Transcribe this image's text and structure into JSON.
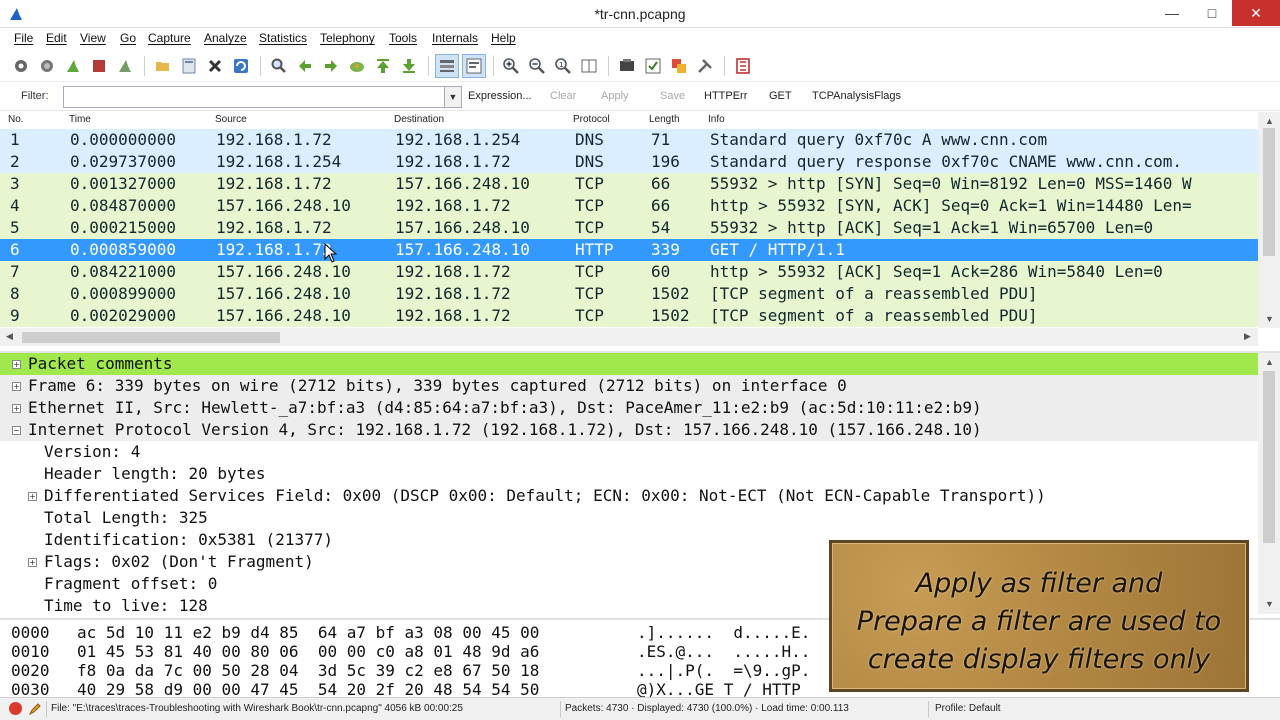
{
  "window": {
    "title": "*tr-cnn.pcapng"
  },
  "menu": [
    "File",
    "Edit",
    "View",
    "Go",
    "Capture",
    "Analyze",
    "Statistics",
    "Telephony",
    "Tools",
    "Internals",
    "Help"
  ],
  "filter": {
    "label": "Filter:",
    "value": "",
    "links": [
      "Expression...",
      "Clear",
      "Apply",
      "Save",
      "HTTPErr",
      "GET",
      "TCPAnalysisFlags"
    ]
  },
  "packet_list": {
    "headers": [
      "No.",
      "Time",
      "Source",
      "Destination",
      "Protocol",
      "Length",
      "Info"
    ],
    "rows": [
      {
        "no": "1",
        "time": "0.000000000",
        "src": "192.168.1.72",
        "dst": "192.168.1.254",
        "proto": "DNS",
        "len": "71",
        "info": "Standard query 0xf70c  A www.cnn.com",
        "kind": "dns"
      },
      {
        "no": "2",
        "time": "0.029737000",
        "src": "192.168.1.254",
        "dst": "192.168.1.72",
        "proto": "DNS",
        "len": "196",
        "info": "Standard query response 0xf70c  CNAME www.cnn.com.",
        "kind": "dns"
      },
      {
        "no": "3",
        "time": "0.001327000",
        "src": "192.168.1.72",
        "dst": "157.166.248.10",
        "proto": "TCP",
        "len": "66",
        "info": "55932 > http [SYN] Seq=0 Win=8192 Len=0 MSS=1460 W",
        "kind": "tcp"
      },
      {
        "no": "4",
        "time": "0.084870000",
        "src": "157.166.248.10",
        "dst": "192.168.1.72",
        "proto": "TCP",
        "len": "66",
        "info": "http > 55932 [SYN, ACK] Seq=0 Ack=1 Win=14480 Len=",
        "kind": "tcp"
      },
      {
        "no": "5",
        "time": "0.000215000",
        "src": "192.168.1.72",
        "dst": "157.166.248.10",
        "proto": "TCP",
        "len": "54",
        "info": "55932 > http [ACK] Seq=1 Ack=1 Win=65700 Len=0",
        "kind": "tcp"
      },
      {
        "no": "6",
        "time": "0.000859000",
        "src": "192.168.1.72",
        "dst": "157.166.248.10",
        "proto": "HTTP",
        "len": "339",
        "info": "GET / HTTP/1.1",
        "kind": "sel"
      },
      {
        "no": "7",
        "time": "0.084221000",
        "src": "157.166.248.10",
        "dst": "192.168.1.72",
        "proto": "TCP",
        "len": "60",
        "info": "http > 55932 [ACK] Seq=1 Ack=286 Win=5840 Len=0",
        "kind": "tcp"
      },
      {
        "no": "8",
        "time": "0.000899000",
        "src": "157.166.248.10",
        "dst": "192.168.1.72",
        "proto": "TCP",
        "len": "1502",
        "info": "[TCP segment of a reassembled PDU]",
        "kind": "tcp"
      },
      {
        "no": "9",
        "time": "0.002029000",
        "src": "157.166.248.10",
        "dst": "192.168.1.72",
        "proto": "TCP",
        "len": "1502",
        "info": "[TCP segment of a reassembled PDU]",
        "kind": "tcp"
      }
    ]
  },
  "details": [
    {
      "text": "Packet comments",
      "indent": 0,
      "expander": "+",
      "style": "comment"
    },
    {
      "text": "Frame 6: 339 bytes on wire (2712 bits), 339 bytes captured (2712 bits) on interface 0",
      "indent": 0,
      "expander": "+",
      "style": "frame"
    },
    {
      "text": "Ethernet II, Src: Hewlett-_a7:bf:a3 (d4:85:64:a7:bf:a3), Dst: PaceAmer_11:e2:b9 (ac:5d:10:11:e2:b9)",
      "indent": 0,
      "expander": "+",
      "style": "frame"
    },
    {
      "text": "Internet Protocol Version 4, Src: 192.168.1.72 (192.168.1.72), Dst: 157.166.248.10 (157.166.248.10)",
      "indent": 0,
      "expander": "-",
      "style": "frame"
    },
    {
      "text": "Version: 4",
      "indent": 1,
      "expander": "",
      "style": ""
    },
    {
      "text": "Header length: 20 bytes",
      "indent": 1,
      "expander": "",
      "style": ""
    },
    {
      "text": "Differentiated Services Field: 0x00 (DSCP 0x00: Default; ECN: 0x00: Not-ECT (Not ECN-Capable Transport))",
      "indent": 1,
      "expander": "+",
      "style": ""
    },
    {
      "text": "Total Length: 325",
      "indent": 1,
      "expander": "",
      "style": ""
    },
    {
      "text": "Identification: 0x5381 (21377)",
      "indent": 1,
      "expander": "",
      "style": ""
    },
    {
      "text": "Flags: 0x02 (Don't Fragment)",
      "indent": 1,
      "expander": "+",
      "style": ""
    },
    {
      "text": "Fragment offset: 0",
      "indent": 1,
      "expander": "",
      "style": ""
    },
    {
      "text": "Time to live: 128",
      "indent": 1,
      "expander": "",
      "style": ""
    }
  ],
  "bytes": [
    {
      "offset": "0000",
      "hex": "ac 5d 10 11 e2 b9 d4 85  64 a7 bf a3 08 00 45 00",
      "ascii": ".]......  d.....E."
    },
    {
      "offset": "0010",
      "hex": "01 45 53 81 40 00 80 06  00 00 c0 a8 01 48 9d a6",
      "ascii": ".ES.@...  .....H.."
    },
    {
      "offset": "0020",
      "hex": "f8 0a da 7c 00 50 28 04  3d 5c 39 c2 e8 67 50 18",
      "ascii": "...|.P(.  =\\9..gP."
    },
    {
      "offset": "0030",
      "hex": "40 29 58 d9 00 00 47 45  54 20 2f 20 48 54 54 50",
      "ascii": "@)X...GE T / HTTP"
    }
  ],
  "overlay": {
    "lines": [
      "Apply as filter and",
      "Prepare a filter are used to",
      "create display filters only"
    ]
  },
  "status": {
    "file": "File: \"E:\\traces\\traces-Troubleshooting with Wireshark Book\\tr-cnn.pcapng\" 4056 kB 00:00:25",
    "packets": "Packets: 4730 · Displayed: 4730 (100.0%) · Load time: 0:00.113",
    "profile": "Profile: Default"
  },
  "colors": {
    "dns_row": "#daeeff",
    "tcp_row": "#e7f6cf",
    "selected_row": "#3399ff",
    "comment_row": "#a0e84b",
    "close_button": "#c7312c"
  }
}
